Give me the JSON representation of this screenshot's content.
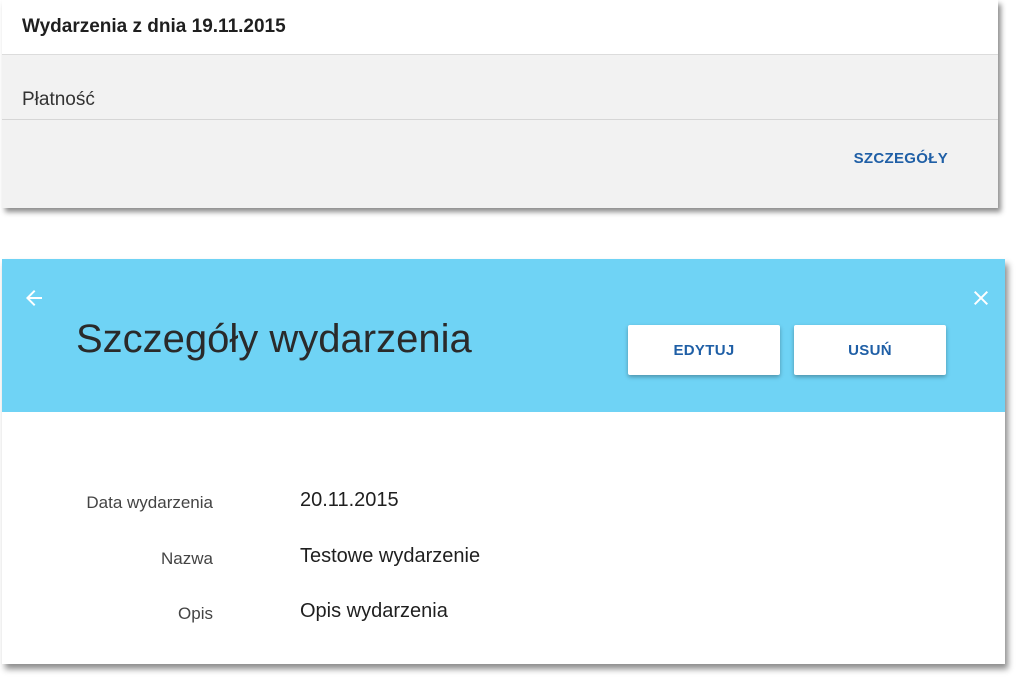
{
  "events_card": {
    "title": "Wydarzenia z dnia 19.11.2015",
    "event_type": "Płatność",
    "details_link": "SZCZEGÓŁY"
  },
  "details_card": {
    "title": "Szczegóły wydarzenia",
    "back_icon": "arrow-left-icon",
    "close_icon": "close-icon",
    "edit_label": "EDYTUJ",
    "delete_label": "USUŃ",
    "banner_color": "#6fd3f5",
    "fields": [
      {
        "label": "Data wydarzenia",
        "value": "20.11.2015"
      },
      {
        "label": "Nazwa",
        "value": "Testowe wydarzenie"
      },
      {
        "label": "Opis",
        "value": "Opis wydarzenia"
      }
    ]
  }
}
